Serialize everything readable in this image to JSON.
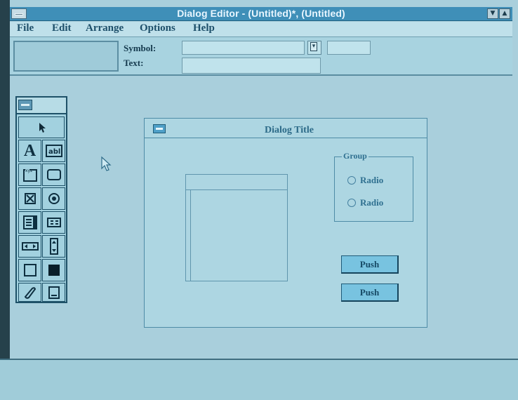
{
  "window": {
    "title": "Dialog Editor - (Untitled)*, (Untitled)"
  },
  "menu": {
    "items": [
      "File",
      "Edit",
      "Arrange",
      "Options",
      "Help"
    ]
  },
  "toolbar": {
    "symbol_label": "Symbol:",
    "text_label": "Text:",
    "symbol_value": "",
    "id_value": "",
    "text_value": ""
  },
  "toolbox": {
    "tools": [
      "pointer-icon",
      "static-text-icon",
      "edit-text-icon",
      "group-box-icon",
      "push-button-icon",
      "check-box-icon",
      "radio-button-icon",
      "list-box-icon",
      "combo-box-icon",
      "horizontal-scroll-icon",
      "vertical-scroll-icon",
      "frame-icon",
      "black-rect-icon",
      "custom-control-icon",
      "icon-control-icon"
    ]
  },
  "dialog": {
    "title": "Dialog Title",
    "group_label": "Group",
    "radios": [
      "Radio",
      "Radio"
    ],
    "buttons": [
      "Push",
      "Push"
    ]
  },
  "colors": {
    "background": "#a9cfdc",
    "titlebar": "#3f8fb8",
    "accent": "#2c6a88"
  }
}
